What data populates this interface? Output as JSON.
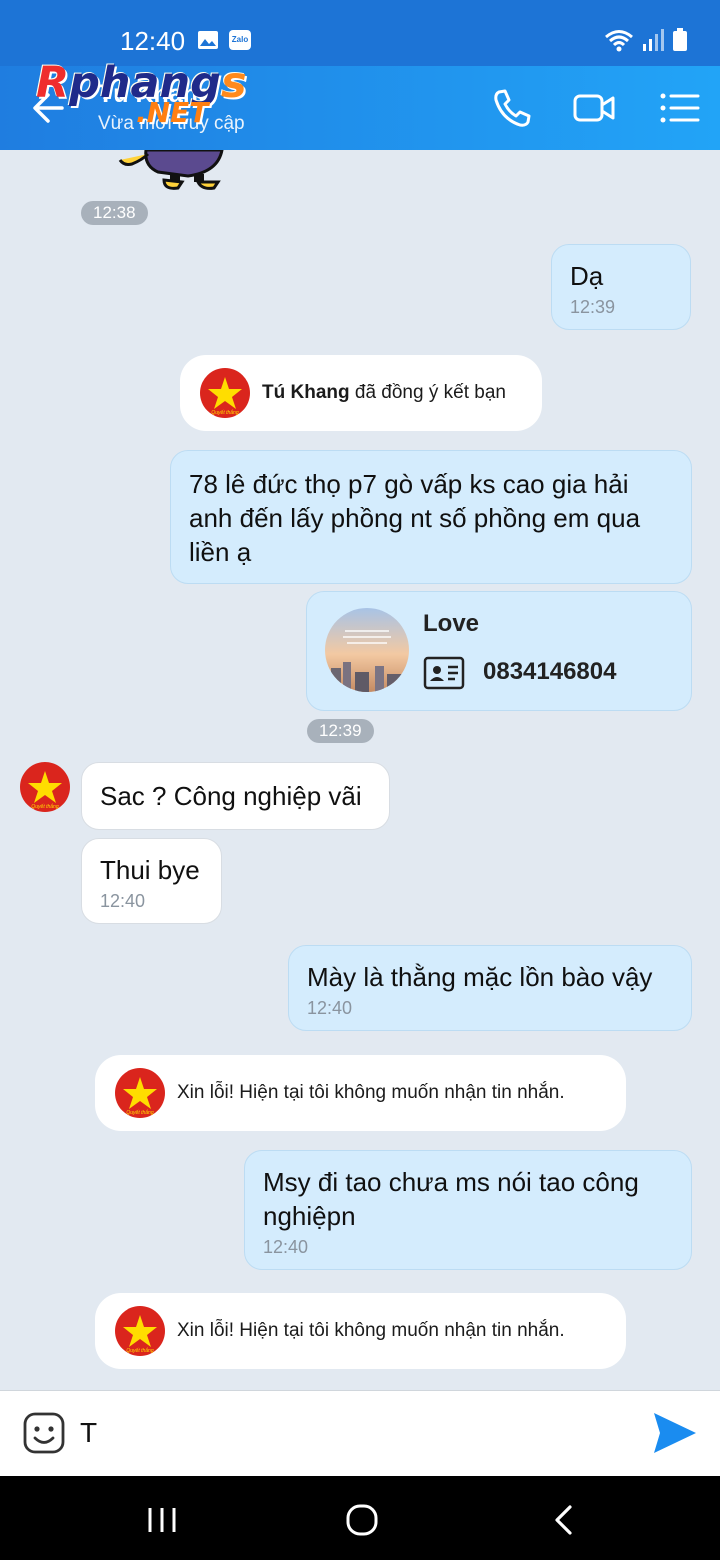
{
  "status": {
    "time": "12:40",
    "zalo_badge": "Zalo"
  },
  "header": {
    "name": "Tú Khang",
    "subtitle": "Vừa mới truy cập"
  },
  "watermark": {
    "main_a": "R",
    "main_b": "phang",
    "main_c": "s",
    "net": ".NET"
  },
  "messages": {
    "t1238": "12:38",
    "da": {
      "text": "Dạ",
      "time": "12:39"
    },
    "friend_accept": {
      "name": "Tú Khang",
      "text": " đã đồng ý kết bạn"
    },
    "address": {
      "text": "78 lê đức thọ p7 gò vấp ks cao gia hải anh đến lấy phồng nt số phồng em qua liền ạ"
    },
    "card": {
      "name": "Love",
      "phone": "0834146804"
    },
    "t1239": "12:39",
    "sac": {
      "text": "Sac ? Công nghiệp vãi"
    },
    "thui": {
      "text": "Thui bye",
      "time": "12:40"
    },
    "may": {
      "text": "Mày là thằng mặc lồn bào vậy",
      "time": "12:40"
    },
    "blocked1": "Xin lỗi! Hiện tại tôi không muốn nhận tin nhắn.",
    "msy": {
      "text": "Msy đi tao chưa ms nói tao công nghiệpn",
      "time": "12:40"
    },
    "blocked2": "Xin lỗi! Hiện tại tôi không muốn nhận tin nhắn."
  },
  "avatar_caption": "Quyết thắng",
  "input": {
    "value": "T"
  },
  "colors": {
    "header": "#1f7de0",
    "outgoing": "#d4ecfd",
    "incoming": "#ffffff",
    "background": "#e2e9f1",
    "send": "#1a8cf0"
  }
}
